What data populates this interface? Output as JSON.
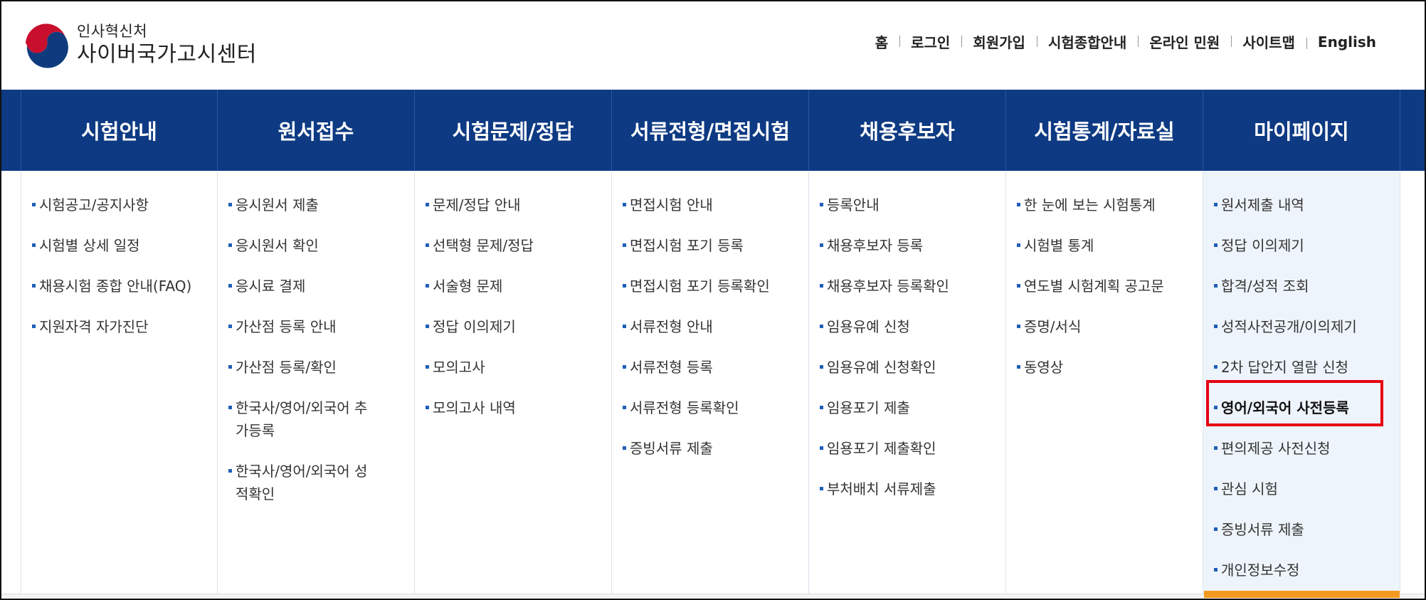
{
  "header": {
    "logo_sub": "인사혁신처",
    "logo_main": "사이버국가고시센터",
    "util_nav": [
      "홈",
      "로그인",
      "회원가입",
      "시험종합안내",
      "온라인 민원",
      "사이트맵",
      "English"
    ]
  },
  "gnb": {
    "menus": [
      {
        "label": "시험안내",
        "items": [
          "시험공고/공지사항",
          "시험별 상세 일정",
          "채용시험 종합 안내(FAQ)",
          "지원자격 자가진단"
        ]
      },
      {
        "label": "원서접수",
        "items": [
          "응시원서 제출",
          "응시원서 확인",
          "응시료 결제",
          "가산점 등록 안내",
          "가산점 등록/확인",
          "한국사/영어/외국어 추가등록",
          "한국사/영어/외국어 성적확인"
        ]
      },
      {
        "label": "시험문제/정답",
        "items": [
          "문제/정답 안내",
          "선택형 문제/정답",
          "서술형 문제",
          "정답 이의제기",
          "모의고사",
          "모의고사 내역"
        ]
      },
      {
        "label": "서류전형/면접시험",
        "items": [
          "면접시험 안내",
          "면접시험 포기 등록",
          "면접시험 포기 등록확인",
          "서류전형 안내",
          "서류전형 등록",
          "서류전형 등록확인",
          "증빙서류 제출"
        ]
      },
      {
        "label": "채용후보자",
        "items": [
          "등록안내",
          "채용후보자 등록",
          "채용후보자 등록확인",
          "임용유예 신청",
          "임용유예 신청확인",
          "임용포기 제출",
          "임용포기 제출확인",
          "부처배치 서류제출"
        ]
      },
      {
        "label": "시험통계/자료실",
        "items": [
          "한 눈에 보는 시험통계",
          "시험별 통계",
          "연도별 시험계획 공고문",
          "증명/서식",
          "동영상"
        ]
      },
      {
        "label": "마이페이지",
        "items": [
          "원서제출 내역",
          "정답 이의제기",
          "합격/성적 조회",
          "성적사전공개/이의제기",
          "2차 답안지 열람 신청",
          "영어/외국어 사전등록",
          "편의제공 사전신청",
          "관심 시험",
          "증빙서류 제출",
          "개인정보수정"
        ]
      }
    ]
  },
  "colors": {
    "nav_bg": "#0e3a83",
    "highlight_border": "#e60012",
    "bullet": "#1f5fb8",
    "accent_bar": "#f39a1e"
  }
}
